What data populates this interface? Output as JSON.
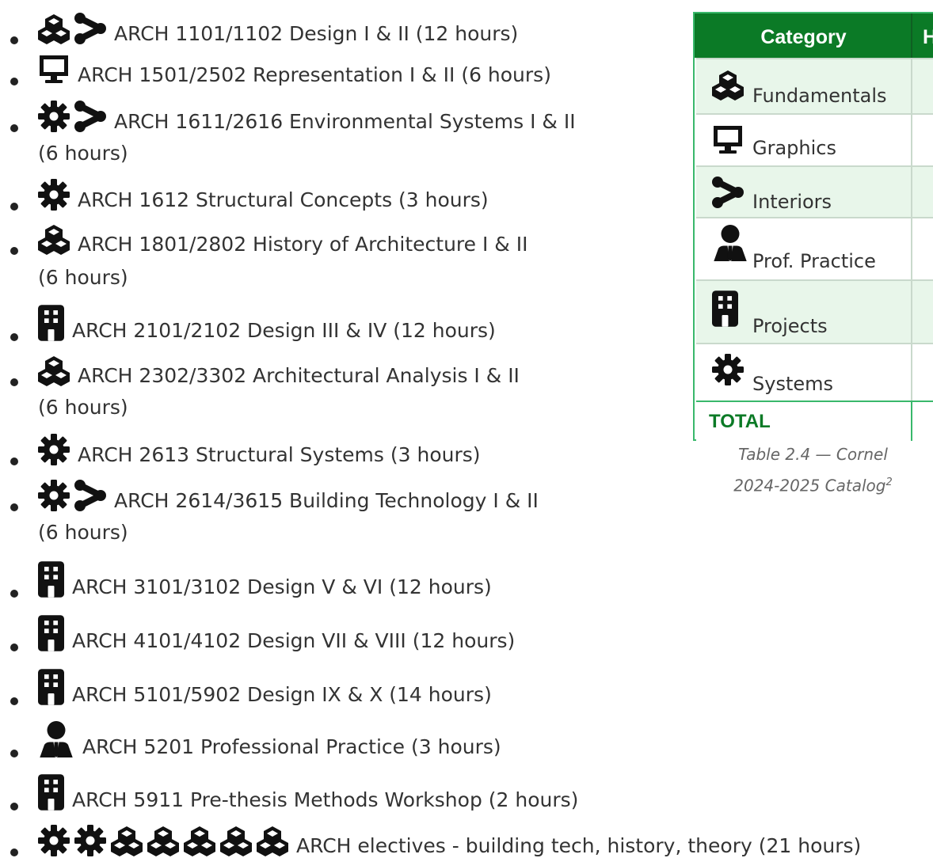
{
  "courses": [
    {
      "icons": [
        "cubes-icon",
        "share-icon"
      ],
      "text": "ARCH 1101/1102 Design I & II (12 hours)",
      "continuation": ""
    },
    {
      "icons": [
        "monitor-icon"
      ],
      "text": "ARCH 1501/2502 Representation I & II (6 hours)",
      "continuation": ""
    },
    {
      "icons": [
        "gear-icon",
        "share-icon"
      ],
      "text": "ARCH 1611/2616 Environmental Systems I & II",
      "continuation": "(6 hours)"
    },
    {
      "icons": [
        "gear-icon"
      ],
      "text": "ARCH 1612 Structural Concepts (3 hours)",
      "continuation": ""
    },
    {
      "icons": [
        "cubes-icon"
      ],
      "text": "ARCH 1801/2802 History of Architecture I & II",
      "continuation": "(6 hours)"
    },
    {
      "icons": [
        "building-icon"
      ],
      "text": "ARCH 2101/2102 Design III & IV (12 hours)",
      "continuation": ""
    },
    {
      "icons": [
        "cubes-icon"
      ],
      "text": "ARCH 2302/3302 Architectural Analysis I & II",
      "continuation": "(6 hours)"
    },
    {
      "icons": [
        "gear-icon"
      ],
      "text": "ARCH 2613 Structural Systems (3 hours)",
      "continuation": ""
    },
    {
      "icons": [
        "gear-icon",
        "share-icon"
      ],
      "text": "ARCH 2614/3615 Building Technology I & II",
      "continuation": "(6 hours)"
    },
    {
      "icons": [
        "building-icon"
      ],
      "text": "ARCH 3101/3102 Design V & VI (12 hours)",
      "continuation": ""
    },
    {
      "icons": [
        "building-icon"
      ],
      "text": "ARCH 4101/4102 Design VII & VIII (12 hours)",
      "continuation": ""
    },
    {
      "icons": [
        "building-icon"
      ],
      "text": "ARCH 5101/5902 Design IX & X (14 hours)",
      "continuation": ""
    },
    {
      "icons": [
        "user-tie-icon"
      ],
      "text": "ARCH 5201 Professional Practice (3 hours)",
      "continuation": ""
    },
    {
      "icons": [
        "building-icon"
      ],
      "text": "ARCH 5911 Pre-thesis Methods Workshop (2 hours)",
      "continuation": ""
    },
    {
      "icons": [
        "gear-icon",
        "gear-icon",
        "cubes-icon",
        "cubes-icon",
        "cubes-icon",
        "cubes-icon",
        "cubes-icon"
      ],
      "text": "ARCH electives - building tech, history, theory (21 hours)",
      "continuation": ""
    }
  ],
  "table": {
    "header": {
      "category": "Category",
      "hours_partial": "H"
    },
    "rows": [
      {
        "icon": "cubes-icon",
        "label": "Fundamentals"
      },
      {
        "icon": "monitor-icon",
        "label": "Graphics"
      },
      {
        "icon": "share-icon",
        "label": "Interiors"
      },
      {
        "icon": "user-tie-icon",
        "label": "Prof. Practice"
      },
      {
        "icon": "building-icon",
        "label": "Projects"
      },
      {
        "icon": "gear-icon",
        "label": "Systems"
      }
    ],
    "total_label": "TOTAL",
    "caption_line1": "Table 2.4 — Cornel",
    "caption_line2": "2024-2025 Catalog",
    "caption_sup": "2"
  },
  "colors": {
    "header_bg": "#0b7a26",
    "row_alt_bg": "#e8f6ea",
    "border": "#39b86b",
    "total_text": "#0b7a26",
    "text": "#333333",
    "icon": "#111111"
  }
}
